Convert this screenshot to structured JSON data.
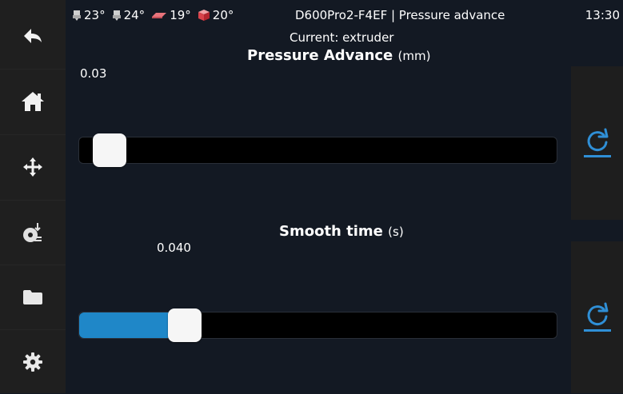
{
  "temps": [
    {
      "icon": "extruder-icon",
      "value": "23°"
    },
    {
      "icon": "extruder-icon",
      "value": "24°"
    },
    {
      "icon": "heated-bed-icon",
      "value": "19°"
    },
    {
      "icon": "chamber-icon",
      "value": "20°"
    }
  ],
  "header": {
    "title": "D600Pro2-F4EF | Pressure advance",
    "time": "13:30",
    "current": "Current: extruder"
  },
  "sidebar": {
    "items": [
      {
        "icon": "back-icon"
      },
      {
        "icon": "home-icon"
      },
      {
        "icon": "move-icon"
      },
      {
        "icon": "extrude-icon"
      },
      {
        "icon": "folder-icon"
      },
      {
        "icon": "settings-icon"
      }
    ]
  },
  "pressure_advance": {
    "label": "Pressure Advance",
    "unit": "(mm)",
    "value": "0.03",
    "fraction": 0.03
  },
  "smooth_time": {
    "label": "Smooth time",
    "unit": "(s)",
    "value": "0.040",
    "fraction": 0.2
  },
  "colors": {
    "background": "#131923",
    "sidebar": "#1f1f1f",
    "accent": "#1f87c8"
  }
}
